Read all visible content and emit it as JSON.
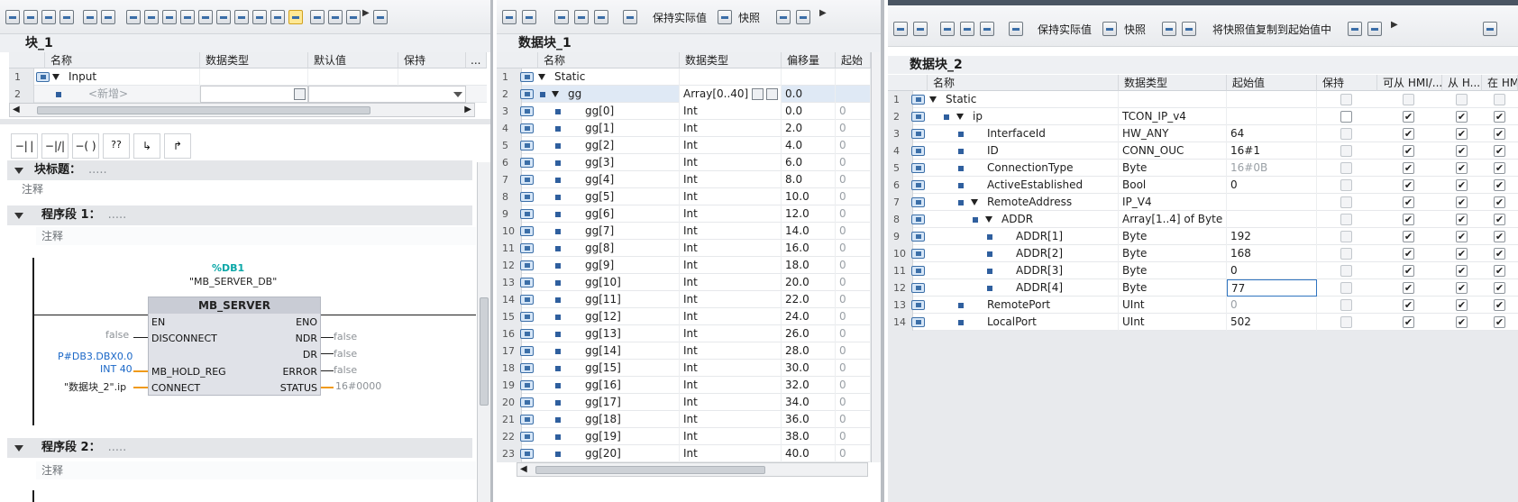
{
  "colors": {
    "accent": "#3c6fa8",
    "wire_orange": "#f09a18",
    "db_teal": "#0aa7a7",
    "link_blue": "#1a67c7"
  },
  "pane1": {
    "toolbar_icons": [
      "insert-row-icon",
      "delete-row-icon",
      "insert-network-icon",
      "delete-network-icon",
      "insert-block-icon",
      "monitor-icon",
      "align-left-icon",
      "align-center-icon",
      "align-right-icon",
      "comment-icon",
      "zoom-in-icon",
      "zoom-out-icon",
      "list-icon",
      "indent-icon",
      "outdent-icon",
      "favorite-icon",
      "goto-icon",
      "goto-next-icon",
      "goto-prev-icon",
      "layout-icon"
    ],
    "title": "块_1",
    "columns": [
      "名称",
      "数据类型",
      "默认值",
      "保持"
    ],
    "col_more": "...",
    "rows": [
      {
        "num": "1",
        "name": "Input"
      },
      {
        "num": "2",
        "name": "<新增>"
      }
    ],
    "instructions": [
      "contact-no-icon",
      "contact-nc-icon",
      "coil-icon",
      "box-icon",
      "open-branch-icon",
      "close-branch-icon"
    ],
    "block_title": "块标题：",
    "block_title_dots": ".....",
    "block_comment": "注释",
    "networks": [
      {
        "label": "程序段 1：",
        "dots": ".....",
        "comment": "注释"
      },
      {
        "label": "程序段 2：",
        "dots": ".....",
        "comment": "注释"
      }
    ],
    "ladder": {
      "db_ref": "%DB1",
      "db_name": "\"MB_SERVER_DB\"",
      "fb_name": "MB_SERVER",
      "pins_in": [
        "EN",
        "DISCONNECT",
        "MB_HOLD_REG",
        "CONNECT"
      ],
      "pins_out": [
        "ENO",
        "NDR",
        "DR",
        "ERROR",
        "STATUS"
      ],
      "in_disconnect": "false",
      "in_holdreg_1": "P#DB3.DBX0.0",
      "in_holdreg_2": "INT 40",
      "in_connect": "\"数据块_2\".ip",
      "out_ndr": "false",
      "out_dr": "false",
      "out_error": "false",
      "out_status": "16#0000"
    }
  },
  "pane2": {
    "buttons": {
      "keep_actual": "保持实际值",
      "snapshot": "快照"
    },
    "title": "数据块_1",
    "columns": [
      "名称",
      "数据类型",
      "偏移量",
      "起始"
    ],
    "rows": [
      {
        "num": "1",
        "name": "Static",
        "type": "",
        "offset": "",
        "start": ""
      },
      {
        "num": "2",
        "name": "gg",
        "type": "Array[0..40] ...",
        "offset": "0.0",
        "start": ""
      },
      {
        "num": "3",
        "name": "gg[0]",
        "type": "Int",
        "offset": "0.0",
        "start": "0"
      },
      {
        "num": "4",
        "name": "gg[1]",
        "type": "Int",
        "offset": "2.0",
        "start": "0"
      },
      {
        "num": "5",
        "name": "gg[2]",
        "type": "Int",
        "offset": "4.0",
        "start": "0"
      },
      {
        "num": "6",
        "name": "gg[3]",
        "type": "Int",
        "offset": "6.0",
        "start": "0"
      },
      {
        "num": "7",
        "name": "gg[4]",
        "type": "Int",
        "offset": "8.0",
        "start": "0"
      },
      {
        "num": "8",
        "name": "gg[5]",
        "type": "Int",
        "offset": "10.0",
        "start": "0"
      },
      {
        "num": "9",
        "name": "gg[6]",
        "type": "Int",
        "offset": "12.0",
        "start": "0"
      },
      {
        "num": "10",
        "name": "gg[7]",
        "type": "Int",
        "offset": "14.0",
        "start": "0"
      },
      {
        "num": "11",
        "name": "gg[8]",
        "type": "Int",
        "offset": "16.0",
        "start": "0"
      },
      {
        "num": "12",
        "name": "gg[9]",
        "type": "Int",
        "offset": "18.0",
        "start": "0"
      },
      {
        "num": "13",
        "name": "gg[10]",
        "type": "Int",
        "offset": "20.0",
        "start": "0"
      },
      {
        "num": "14",
        "name": "gg[11]",
        "type": "Int",
        "offset": "22.0",
        "start": "0"
      },
      {
        "num": "15",
        "name": "gg[12]",
        "type": "Int",
        "offset": "24.0",
        "start": "0"
      },
      {
        "num": "16",
        "name": "gg[13]",
        "type": "Int",
        "offset": "26.0",
        "start": "0"
      },
      {
        "num": "17",
        "name": "gg[14]",
        "type": "Int",
        "offset": "28.0",
        "start": "0"
      },
      {
        "num": "18",
        "name": "gg[15]",
        "type": "Int",
        "offset": "30.0",
        "start": "0"
      },
      {
        "num": "19",
        "name": "gg[16]",
        "type": "Int",
        "offset": "32.0",
        "start": "0"
      },
      {
        "num": "20",
        "name": "gg[17]",
        "type": "Int",
        "offset": "34.0",
        "start": "0"
      },
      {
        "num": "21",
        "name": "gg[18]",
        "type": "Int",
        "offset": "36.0",
        "start": "0"
      },
      {
        "num": "22",
        "name": "gg[19]",
        "type": "Int",
        "offset": "38.0",
        "start": "0"
      },
      {
        "num": "23",
        "name": "gg[20]",
        "type": "Int",
        "offset": "40.0",
        "start": "0"
      }
    ]
  },
  "pane3": {
    "buttons": {
      "keep_actual": "保持实际值",
      "snapshot": "快照",
      "copy_snapshot": "将快照值复制到起始值中"
    },
    "title": "数据块_2",
    "columns": [
      "名称",
      "数据类型",
      "起始值",
      "保持",
      "可从 HMI/...",
      "从 H...",
      "在 HMI ..."
    ],
    "rows": [
      {
        "num": "1",
        "name": "Static",
        "type": "",
        "start": "",
        "indent": 0,
        "expand": true,
        "keep": "dis",
        "hmi1": "dis",
        "hmi2": "dis",
        "hmi3": "dis"
      },
      {
        "num": "2",
        "name": "ip",
        "type": "TCON_IP_v4",
        "start": "",
        "indent": 1,
        "expand": true,
        "keep": "off",
        "hmi1": "on",
        "hmi2": "on",
        "hmi3": "on"
      },
      {
        "num": "3",
        "name": "InterfaceId",
        "type": "HW_ANY",
        "start": "64",
        "indent": 2,
        "expand": false,
        "keep": "dis",
        "hmi1": "on",
        "hmi2": "on",
        "hmi3": "on"
      },
      {
        "num": "4",
        "name": "ID",
        "type": "CONN_OUC",
        "start": "16#1",
        "indent": 2,
        "expand": false,
        "keep": "dis",
        "hmi1": "on",
        "hmi2": "on",
        "hmi3": "on"
      },
      {
        "num": "5",
        "name": "ConnectionType",
        "type": "Byte",
        "start": "16#0B",
        "start_grey": true,
        "indent": 2,
        "expand": false,
        "keep": "dis",
        "hmi1": "on",
        "hmi2": "on",
        "hmi3": "on"
      },
      {
        "num": "6",
        "name": "ActiveEstablished",
        "type": "Bool",
        "start": "0",
        "indent": 2,
        "expand": false,
        "keep": "dis",
        "hmi1": "on",
        "hmi2": "on",
        "hmi3": "on"
      },
      {
        "num": "7",
        "name": "RemoteAddress",
        "type": "IP_V4",
        "start": "",
        "indent": 2,
        "expand": true,
        "keep": "dis",
        "hmi1": "on",
        "hmi2": "on",
        "hmi3": "on"
      },
      {
        "num": "8",
        "name": "ADDR",
        "type": "Array[1..4] of Byte",
        "start": "",
        "indent": 3,
        "expand": true,
        "keep": "dis",
        "hmi1": "on",
        "hmi2": "on",
        "hmi3": "on"
      },
      {
        "num": "9",
        "name": "ADDR[1]",
        "type": "Byte",
        "start": "192",
        "indent": 4,
        "expand": false,
        "keep": "dis",
        "hmi1": "on",
        "hmi2": "on",
        "hmi3": "on"
      },
      {
        "num": "10",
        "name": "ADDR[2]",
        "type": "Byte",
        "start": "168",
        "indent": 4,
        "expand": false,
        "keep": "dis",
        "hmi1": "on",
        "hmi2": "on",
        "hmi3": "on"
      },
      {
        "num": "11",
        "name": "ADDR[3]",
        "type": "Byte",
        "start": "0",
        "indent": 4,
        "expand": false,
        "keep": "dis",
        "hmi1": "on",
        "hmi2": "on",
        "hmi3": "on"
      },
      {
        "num": "12",
        "name": "ADDR[4]",
        "type": "Byte",
        "start": "77",
        "indent": 4,
        "expand": false,
        "editing": true,
        "keep": "dis",
        "hmi1": "on",
        "hmi2": "on",
        "hmi3": "on"
      },
      {
        "num": "13",
        "name": "RemotePort",
        "type": "UInt",
        "start": "0",
        "start_grey": true,
        "indent": 2,
        "expand": false,
        "keep": "dis",
        "hmi1": "on",
        "hmi2": "on",
        "hmi3": "on"
      },
      {
        "num": "14",
        "name": "LocalPort",
        "type": "UInt",
        "start": "502",
        "indent": 2,
        "expand": false,
        "keep": "dis",
        "hmi1": "on",
        "hmi2": "on",
        "hmi3": "on"
      }
    ]
  }
}
